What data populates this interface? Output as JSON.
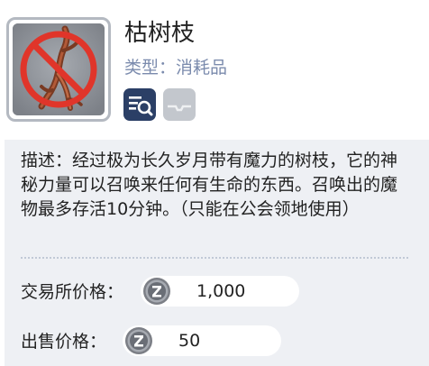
{
  "item": {
    "name": "枯树枝",
    "type_label": "类型：",
    "type_value": "消耗品",
    "icon": "withered-branch-prohibited-icon",
    "status_icons": [
      "inspect-icon",
      "tray-icon"
    ]
  },
  "description": "描述：经过极为长久岁月带有魔力的树枝，它的神秘力量可以召唤来任何有生命的东西。召唤出的魔物最多存活10分钟。（只能在公会领地使用）",
  "prices": {
    "exchange_label": "交易所价格：",
    "exchange_value": "1,000",
    "sell_label": "出售价格：",
    "sell_value": "50",
    "currency_icon": "z-coin-icon"
  },
  "colors": {
    "type_text": "#7b8bad",
    "panel_bg": "#eef0f4",
    "icon_frame": "#b4b9c1",
    "inspect_icon": "#2b3f66",
    "prohibited_red": "#e0352a"
  }
}
